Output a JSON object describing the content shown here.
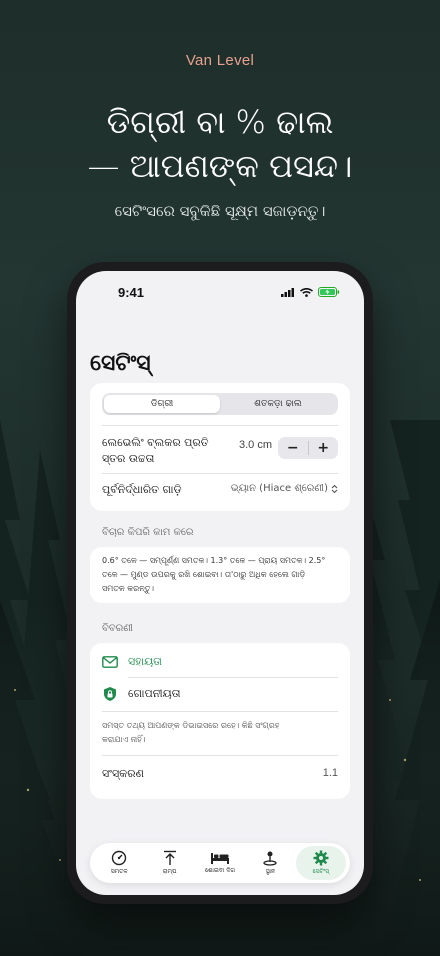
{
  "brand": "Van Level",
  "headline": {
    "line1": "ଡିଗ୍ରୀ ବା % ଢାଲ",
    "line2": "— ଆପଣଙ୍କ ପସନ୍ଦ।"
  },
  "subhead": "ସେଟିଂସରେ ସବୁକିଛି ସୂକ୍ଷ୍ମ ସଜାଡ଼ନ୍ତୁ।",
  "status": {
    "time": "9:41"
  },
  "page_title": "ସେଟିଂସ୍",
  "units": {
    "options": [
      "ଡିଗ୍ରୀ",
      "ଶତକଡ଼ା ଢାଲ"
    ],
    "selected": "ଡିଗ୍ରୀ"
  },
  "block_height": {
    "label": "ଲେଭେଲିଂ ବ୍ଲକର ପ୍ରତି ସ୍ତର ଉଚ୍ଚତା",
    "value": "3.0 cm",
    "minus": "−",
    "plus": "+"
  },
  "vehicle": {
    "label": "ପୂର୍ବନିର୍ଦ୍ଧାରିତ ଗାଡ଼ି",
    "value": "ଭ୍ୟାନ (Hiace ଶ୍ରେଣୀ)"
  },
  "how_it_works": {
    "label": "ବିଚାର କିପରି କାମ କରେ",
    "line1": "0.6° ତଳେ — ସମ୍ପୂର୍ଣ୍ଣ ସମତଳ। 1.3° ତଳେ — ପ୍ରାୟ ସମତଳ। 2.5°",
    "line2": "ତଳେ — ମୁଣ୍ଡ ଉପରକୁ ରଖି ଶୋଇବା। ତା'ଠାରୁ ଅଧିକ ହେଲେ ଗାଡ଼ି",
    "line3": "ସମତଳ କରନ୍ତୁ।"
  },
  "details": {
    "label": "ବିବରଣୀ",
    "support": "ସହାୟତା",
    "privacy": "ଗୋପନୀୟତା",
    "note_line1": "ସମସ୍ତ ତଥ୍ୟ ଆପଣଙ୍କ ଡିଭାଇସରେ ରହେ। କିଛି ସଂଗ୍ରହ",
    "note_line2": "କରାଯାଏ ନାହିଁ।",
    "version_label": "ସଂସ୍କରଣ",
    "version_value": "1.1"
  },
  "tabs": [
    {
      "label": "ସମତଳ",
      "icon": "gauge-icon"
    },
    {
      "label": "ରାମ୍ପ",
      "icon": "ramp-arrow-icon"
    },
    {
      "label": "ଶୋଇବା ଦିଗ",
      "icon": "bed-icon"
    },
    {
      "label": "ସ୍ଥାନ",
      "icon": "location-pin-icon"
    },
    {
      "label": "ସେଟିଂସ୍",
      "icon": "gear-icon"
    }
  ],
  "colors": {
    "accent": "#1f8a4c",
    "brand": "#e8a18f",
    "background": "#1e2e2a"
  }
}
